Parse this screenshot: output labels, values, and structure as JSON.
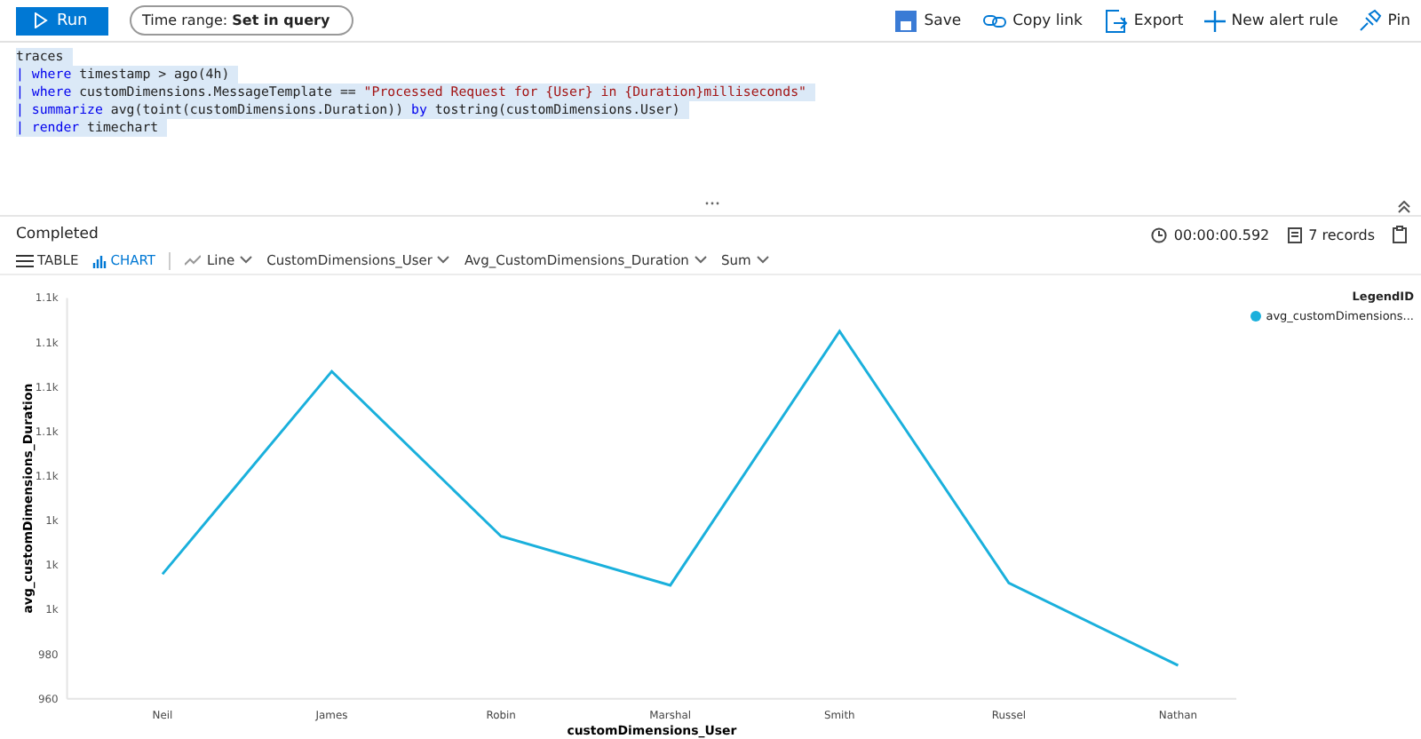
{
  "toolbar": {
    "run": "Run",
    "time_range": "Time range: **Set in query**",
    "actions": [
      {
        "kind": "save",
        "label": "Save"
      },
      {
        "kind": "link",
        "label": "Copy link"
      },
      {
        "kind": "export",
        "label": "Export"
      },
      {
        "kind": "add",
        "label": "New alert rule"
      },
      {
        "kind": "pin",
        "label": "Pin"
      }
    ]
  },
  "editor": {
    "lines": [
      [
        {
          "kind": "plain",
          "text": "traces"
        }
      ],
      [
        {
          "kind": "pipe",
          "text": "| "
        },
        {
          "kind": "keyword",
          "text": "where"
        },
        {
          "kind": "plain",
          "text": " timestamp > ago(4h)"
        }
      ],
      [
        {
          "kind": "pipe",
          "text": "| "
        },
        {
          "kind": "keyword",
          "text": "where"
        },
        {
          "kind": "plain",
          "text": " customDimensions.MessageTemplate == "
        },
        {
          "kind": "string",
          "text": "\"Processed Request for {User} in {Duration}milliseconds\""
        }
      ],
      [
        {
          "kind": "pipe",
          "text": "| "
        },
        {
          "kind": "keyword",
          "text": "summarize"
        },
        {
          "kind": "plain",
          "text": " avg(toint(customDimensions.Duration)) "
        },
        {
          "kind": "keyword",
          "text": "by"
        },
        {
          "kind": "plain",
          "text": " tostring(customDimensions.User)"
        }
      ],
      [
        {
          "kind": "pipe",
          "text": "| "
        },
        {
          "kind": "keyword",
          "text": "render"
        },
        {
          "kind": "plain",
          "text": " timechart"
        }
      ]
    ]
  },
  "status": {
    "text": "Completed",
    "duration": "00:00:00.592",
    "records": "7 records"
  },
  "view_tabs": [
    {
      "kind": "table",
      "label": "TABLE",
      "selected": false
    },
    {
      "kind": "chart",
      "label": "CHART",
      "selected": true
    }
  ],
  "dropdowns": [
    {
      "kind": "chart-type",
      "label": "Line"
    },
    {
      "kind": "plain",
      "label": "CustomDimensions_User"
    },
    {
      "kind": "plain",
      "label": "Avg_CustomDimensions_Duration"
    },
    {
      "kind": "plain",
      "label": "Sum"
    }
  ],
  "legend": {
    "title": "LegendID"
  },
  "chart_data": {
    "type": "line",
    "xlabel": "customDimensions_User",
    "ylabel": "avg_customDimensions_Duration",
    "categories": [
      "Neil",
      "James",
      "Robin",
      "Marshal",
      "Smith",
      "Russel",
      "Nathan"
    ],
    "series": [
      {
        "name": "avg_customDimensions...",
        "color": "#1ab0dc",
        "values": [
          1016,
          1107,
          1033,
          1011,
          1125,
          1012,
          975
        ]
      }
    ],
    "ylim": [
      960,
      1140
    ],
    "yticks": [
      {
        "value": 960,
        "label": "960"
      },
      {
        "value": 980,
        "label": "980"
      },
      {
        "value": 1000,
        "label": "1k"
      },
      {
        "value": 1020,
        "label": "1k"
      },
      {
        "value": 1040,
        "label": "1k"
      },
      {
        "value": 1060,
        "label": "1.1k"
      },
      {
        "value": 1080,
        "label": "1.1k"
      },
      {
        "value": 1100,
        "label": "1.1k"
      },
      {
        "value": 1120,
        "label": "1.1k"
      },
      {
        "value": 1140,
        "label": "1.1k"
      }
    ]
  }
}
